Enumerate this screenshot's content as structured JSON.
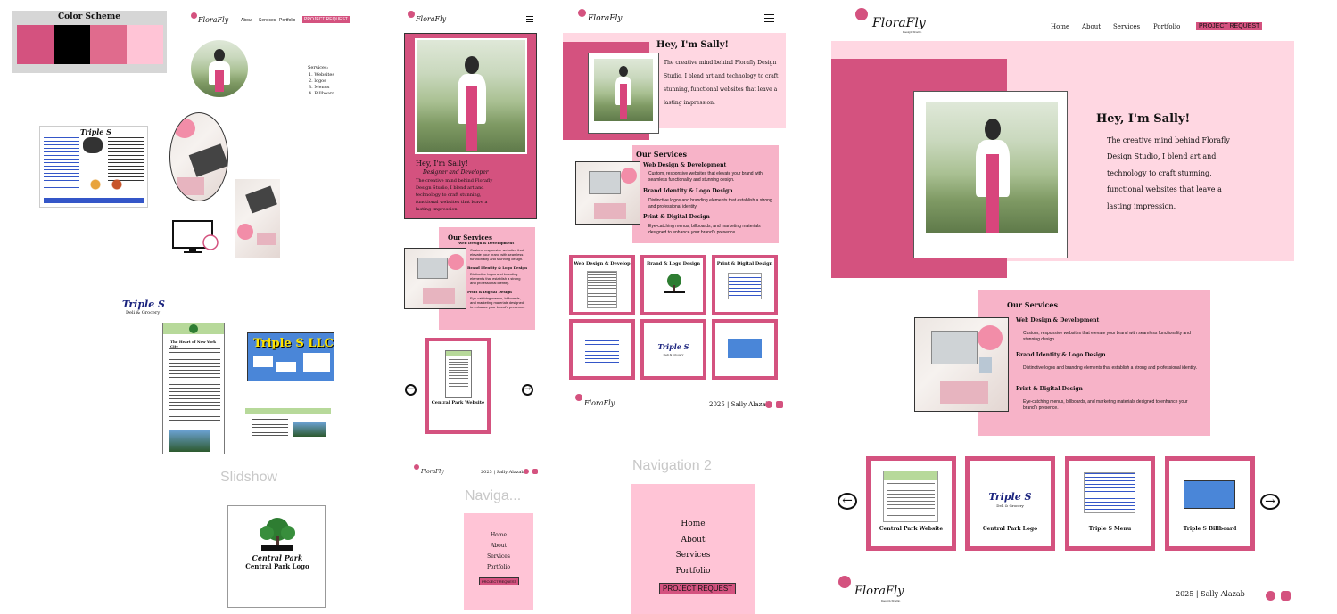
{
  "color_scheme": {
    "title": "Color Scheme",
    "swatches": [
      "#d4527f",
      "#000000",
      "#e06b8d",
      "#ffc4d6"
    ]
  },
  "brand": {
    "logo_text": "FloraFly",
    "logo_sub": "Design Studio"
  },
  "nav": {
    "home": "Home",
    "about": "About",
    "services": "Services",
    "portfolio": "Portfolio",
    "request": "PROJECT REQUEST"
  },
  "draft": {
    "services_heading": "Services:",
    "services_list": [
      "1. Websites",
      "2. logos",
      "3. Menus",
      "4. Billboard"
    ]
  },
  "hero": {
    "greeting": "Hey, I'm Sally!",
    "role": "Designer and Developer",
    "bio": "The creative mind behind Florafly Design Studio, I blend art and technology to craft stunning, functional websites that leave a lasting impression.",
    "bio_lines_full": [
      "The creative mind behind Florafly",
      "Design Studio, I blend art and",
      "technology to craft stunning,",
      "functional websites that leave a",
      "lasting impression."
    ],
    "bio_lines_tab": [
      "The creative mind behind Florafly Design",
      "Studio, I blend art and technology to craft",
      "stunning, functional websites that leave a",
      "lasting impression."
    ],
    "bio_lines_mob": [
      "The creative mind behind Florafly",
      "Design Studio, I blend art and",
      "technology to craft stunning,",
      "functional websites that leave a",
      "lasting impression."
    ]
  },
  "services": {
    "heading": "Our Services",
    "items": [
      {
        "title": "Web Design & Development",
        "desc": "Custom, responsive websites that elevate your brand with seamless functionality and stunning design."
      },
      {
        "title": "Brand Identity & Logo Design",
        "desc": "Distinctive logos and branding elements that establish a strong and professional identity."
      },
      {
        "title": "Print & Digital Design",
        "desc": "Eye-catching menus, billboards, and marketing materials designed to enhance your brand's presence."
      }
    ]
  },
  "portfolio": {
    "cards": [
      "Central Park Website",
      "Central Park Logo",
      "Triple S Menu",
      "Triple S Billboard"
    ],
    "tab_grid_titles": [
      "Web Design & Develop",
      "Brand & Logo Design",
      "Print & Digital Design"
    ],
    "mobile_card": "Central Park Website"
  },
  "footer": {
    "copyright": "2025 | Sally Alazab",
    "copyright_small": "2025 | Sally Alazab"
  },
  "frames": {
    "slideshow": "Slidshow",
    "navigation": "Naviga...",
    "navigation2": "Navigation 2"
  },
  "assets": {
    "triple_s": "Triple S",
    "triple_s_sub": "Deli & Grocery",
    "triple_s_llc": "Triple S LLC",
    "central_park": "Central Park",
    "central_park_logo": "Central Park Logo",
    "heart_ny": "The Heart of New York City"
  },
  "nav_menu": [
    "Home",
    "About",
    "Services",
    "Portfolio"
  ]
}
